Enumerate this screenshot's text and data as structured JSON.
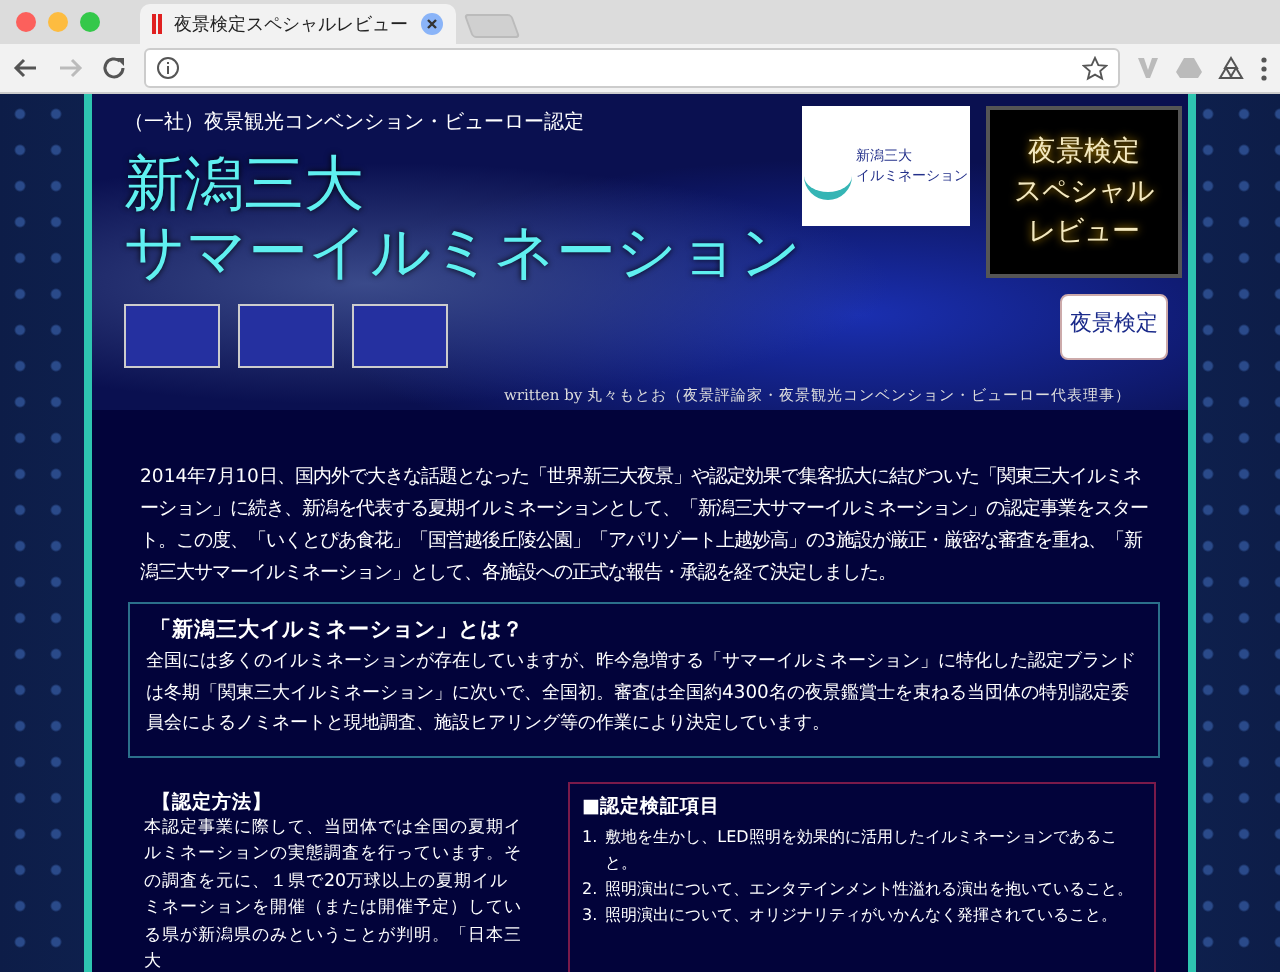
{
  "browser": {
    "tab_title": "夜景検定スペシャルレビュー"
  },
  "header": {
    "subtitle": "（一社）夜景観光コンベンション・ビューロー認定",
    "title_lines": [
      "新潟三大",
      "サマーイルミネーション"
    ],
    "logo_lines": [
      "新潟三大",
      "イルミネーション"
    ],
    "review_badge_lines": [
      "夜景検定",
      "スペシャル",
      "レビュー"
    ],
    "seal_text": "夜景検定",
    "byline": "written by 丸々もとお（夜景評論家・夜景観光コンベンション・ビューロー代表理事）"
  },
  "intro": "2014年7月10日、国内外で大きな話題となった「世界新三大夜景」や認定効果で集客拡大に結びついた「関東三大イルミネーション」に続き、新潟を代表する夏期イルミネーションとして、「新潟三大サマーイルミネーション」の認定事業をスタート。この度、「いくとぴあ食花」「国営越後丘陵公園」「アパリゾート上越妙高」の3施設が厳正・厳密な審査を重ね、「新潟三大サマーイルミネーション」として、各施設への正式な報告・承認を経て決定しました。",
  "about": {
    "heading": "「新潟三大イルミネーション」とは？",
    "body": "全国には多くのイルミネーションが存在していますが、昨今急増する「サマーイルミネーション」に特化した認定ブランドは冬期「関東三大イルミネーション」に次いで、全国初。審査は全国約4300名の夜景鑑賞士を束ねる当団体の特別認定委員会によるノミネートと現地調査、施設ヒアリング等の作業により決定しています。"
  },
  "method": {
    "heading": "【認定方法】",
    "body": "本認定事業に際して、当団体では全国の夏期イルミネーションの実態調査を行っています。その調査を元に、１県で20万球以上の夏期イルミネーションを開催（または開催予定）している県が新潟県のみということが判明。「日本三大"
  },
  "criteria": {
    "heading": "■認定検証項目",
    "items": [
      {
        "number": "1.",
        "text": "敷地を生かし、LED照明を効果的に活用したイルミネーションであること。"
      },
      {
        "number": "2.",
        "text": "照明演出について、エンタテインメント性溢れる演出を抱いていること。"
      },
      {
        "number": "3.",
        "text": "照明演出について、オリジナリティがいかんなく発揮されていること。"
      }
    ]
  }
}
